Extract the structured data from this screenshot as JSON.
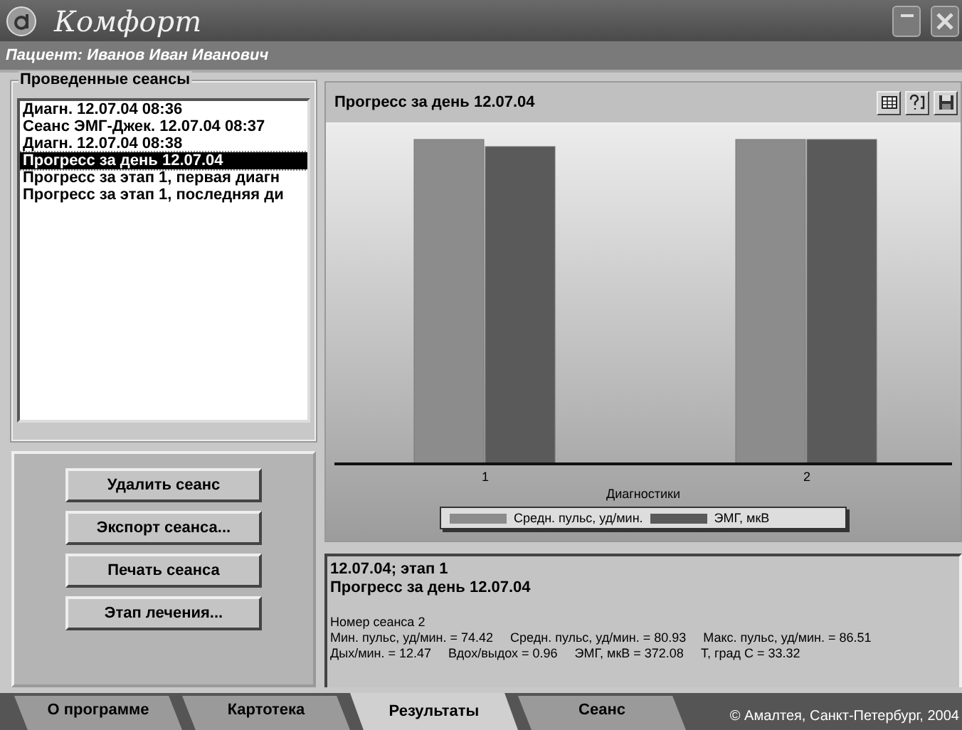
{
  "window": {
    "title": "Комфорт",
    "patient": "Пациент: Иванов Иван Иванович"
  },
  "sessions": {
    "title": "Проведенные сеансы",
    "items": [
      {
        "label": "Диагн. 12.07.04 08:36",
        "selected": false
      },
      {
        "label": "Сеанс ЭМГ-Джек. 12.07.04 08:37",
        "selected": false
      },
      {
        "label": "Диагн. 12.07.04 08:38",
        "selected": false
      },
      {
        "label": "Прогресс за день 12.07.04",
        "selected": true
      },
      {
        "label": "Прогресс за этап 1, первая диагн",
        "selected": false
      },
      {
        "label": "Прогресс за этап 1, последняя ди",
        "selected": false
      }
    ]
  },
  "buttons": [
    "Удалить сеанс",
    "Экспорт сеанса...",
    "Печать сеанса",
    "Этап лечения..."
  ],
  "chart": {
    "title": "Прогресс за день 12.07.04",
    "xlabel": "Диагностики",
    "categories": [
      "1",
      "2"
    ],
    "legend": [
      {
        "name": "Средн. пульс, уд/мин.",
        "color": "#8c8c8c"
      },
      {
        "name": "ЭМГ, мкВ",
        "color": "#5a5a5a"
      }
    ]
  },
  "info": {
    "heading": "12.07.04; этап 1",
    "subheading": "Прогресс за день 12.07.04",
    "lines": [
      [
        "Номер сеанса 2"
      ],
      [
        "Мин. пульс, уд/мин. = 74.42",
        "Средн. пульс, уд/мин. = 80.93",
        "Макс. пульс, уд/мин. = 86.51"
      ],
      [
        "Дых/мин. = 12.47",
        "Вдох/выдох = 0.96",
        "ЭМГ, мкВ = 372.08",
        "Т, град С = 33.32"
      ]
    ]
  },
  "tabs": [
    {
      "label": "О программе",
      "selected": false
    },
    {
      "label": "Картотека",
      "selected": false
    },
    {
      "label": "Результаты",
      "selected": true
    },
    {
      "label": "Сеанс",
      "selected": false
    }
  ],
  "copyright": "© Амалтея, Санкт-Петербург, 2004"
}
